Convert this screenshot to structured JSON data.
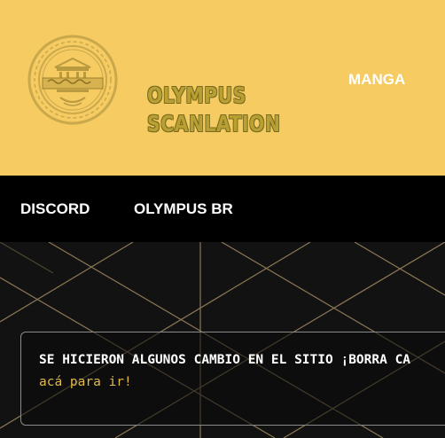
{
  "header": {
    "logo_line1": "OLYMPUS",
    "logo_line2": "SCANLATION",
    "nav_manga": "MANGA"
  },
  "navbar": {
    "discord": "DISCORD",
    "olympus_br": "OLYMPUS BR"
  },
  "notice": {
    "title": "SE HICIERON ALGUNOS CAMBIO EN EL SITIO ¡BORRA CA",
    "link_text": "acá para ir!"
  },
  "colors": {
    "header_bg": "#f5cb62",
    "navbar_bg": "#000000",
    "pattern_bg": "#121212",
    "pattern_lines": "#b49a6a",
    "link": "#e2b94a"
  },
  "icons": {
    "logo_emblem": "greek-temple-emblem-icon"
  }
}
